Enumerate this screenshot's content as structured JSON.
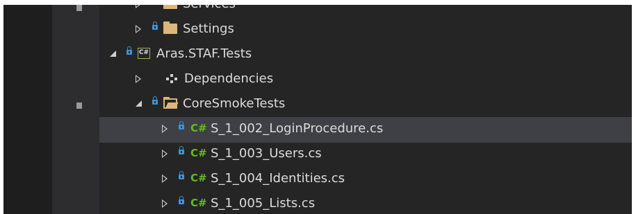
{
  "tree": {
    "services_label": "Services",
    "settings_label": "Settings",
    "project_label": "Aras.STAF.Tests",
    "project_badge": "C#",
    "dependencies_label": "Dependencies",
    "folder_label": "CoreSmokeTests",
    "cs_badge": "C#",
    "files": [
      "S_1_002_LoginProcedure.cs",
      "S_1_003_Users.cs",
      "S_1_004_Identities.cs",
      "S_1_005_Lists.cs"
    ]
  },
  "colors": {
    "background": "#252526",
    "selection": "#3f3f46",
    "folder": "#dcb67a",
    "lock": "#3a96dd",
    "csharp": "#68b723"
  }
}
